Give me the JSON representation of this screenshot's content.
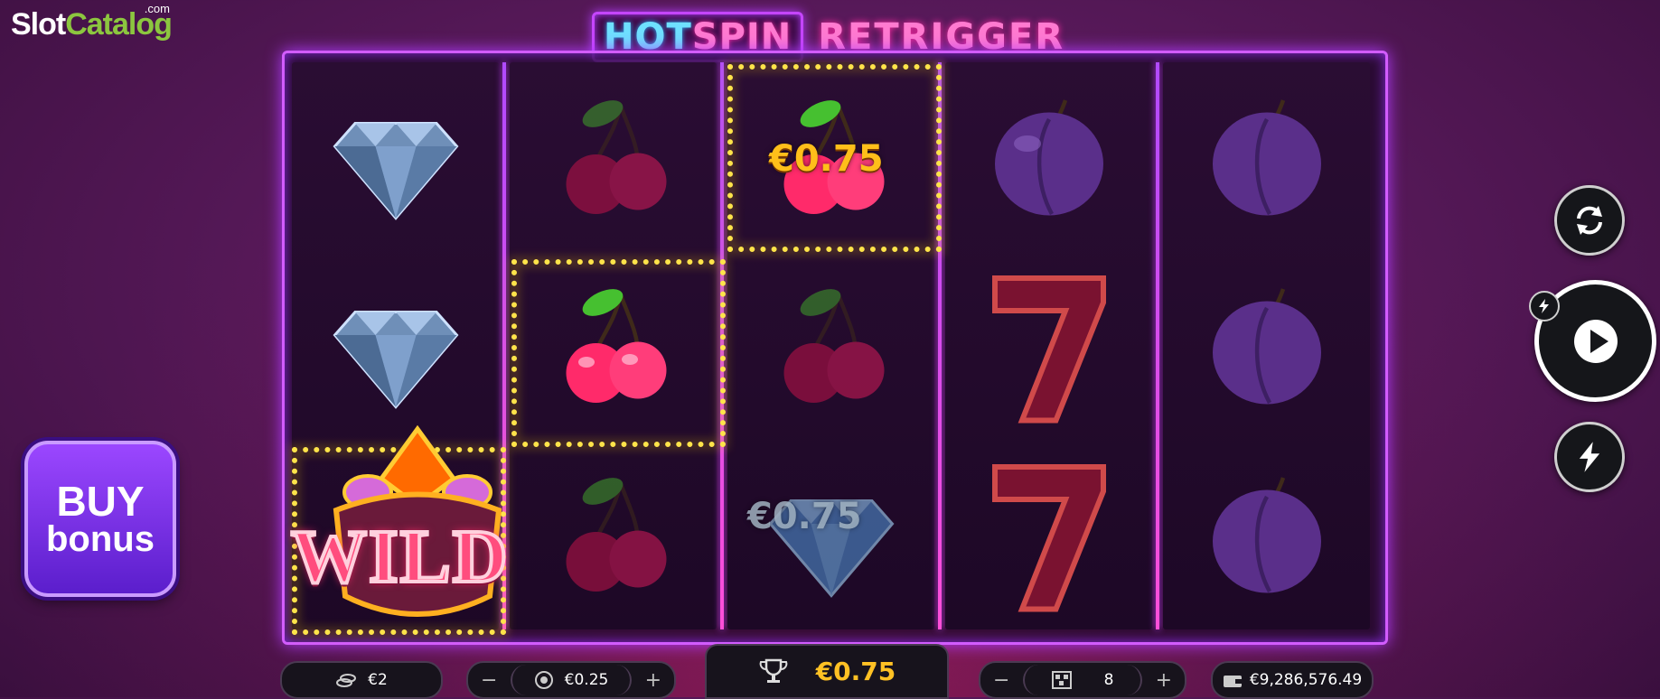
{
  "brand": {
    "name_part1": "Slot",
    "name_part2": "Catalog",
    "suffix": ".com"
  },
  "game": {
    "title_part1": "HOT",
    "title_part2": "SPIN",
    "title_part3": "RETRIGGER"
  },
  "reels": [
    [
      "diamond",
      "diamond",
      "wild"
    ],
    [
      "cherry",
      "cherry",
      "cherry"
    ],
    [
      "cherry",
      "cherry",
      "diamond"
    ],
    [
      "plum",
      "seven",
      "seven"
    ],
    [
      "plum",
      "plum",
      "plum"
    ]
  ],
  "wins": {
    "main_amount": "€0.75",
    "faded_amount": "€0.75"
  },
  "wild": {
    "label": "WILD"
  },
  "buy_bonus": {
    "line1": "BUY",
    "line2": "bonus"
  },
  "controls": {
    "refresh_icon": "refresh-icon",
    "spin_icon": "play-icon",
    "turbo_icon": "lightning-icon"
  },
  "hud": {
    "coins_value": "€2",
    "bet_value": "€0.25",
    "win_value": "€0.75",
    "lines_value": "8",
    "balance_value": "€9,286,576.49",
    "minus": "−",
    "plus": "+"
  },
  "colors": {
    "accent": "#d25cff",
    "gold": "#ffc124",
    "win_dots": "#ffe44a"
  }
}
